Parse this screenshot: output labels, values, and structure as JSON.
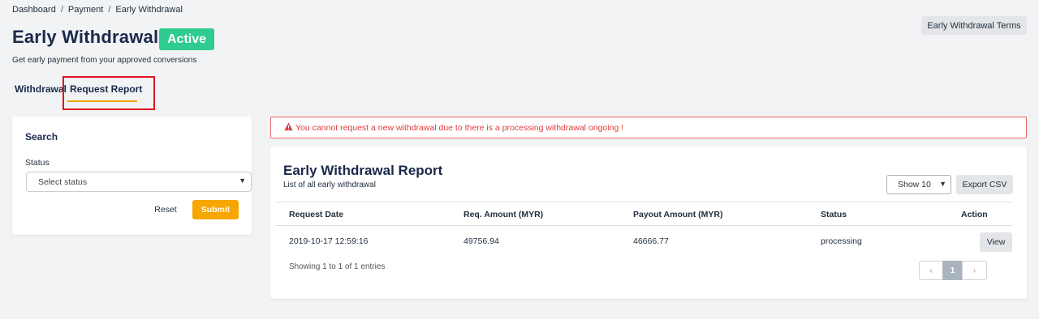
{
  "breadcrumb": [
    "Dashboard",
    "Payment",
    "Early Withdrawal"
  ],
  "header": {
    "title": "Early Withdrawal",
    "status_badge": "Active",
    "subtitle": "Get early payment from your approved conversions",
    "terms_button": "Early Withdrawal Terms"
  },
  "tabs": [
    {
      "label": "Withdrawal"
    },
    {
      "label": "Request Report",
      "active": true
    }
  ],
  "search": {
    "title": "Search",
    "status_label": "Status",
    "status_placeholder": "Select status",
    "reset_label": "Reset",
    "submit_label": "Submit"
  },
  "alert": {
    "message": "You cannot request a new withdrawal due to there is a processing withdrawal ongoing !",
    "icon": "warning-triangle-icon",
    "color": "#e23b3b"
  },
  "report": {
    "title": "Early Withdrawal Report",
    "subtitle": "List of all early withdrawal",
    "show_select": "Show 10",
    "export_label": "Export CSV",
    "columns": [
      "Request Date",
      "Req. Amount (MYR)",
      "Payout Amount (MYR)",
      "Status",
      "Action"
    ],
    "rows": [
      {
        "request_date": "2019-10-17 12:59:16",
        "req_amount": "49756.94",
        "payout_amount": "46666.77",
        "status": "processing",
        "action": "View"
      }
    ],
    "showing": "Showing 1 to 1 of 1 entries",
    "pagination": {
      "prev": "‹",
      "current": "1",
      "next": "›"
    }
  },
  "colors": {
    "accent": "#f7a600",
    "badge": "#2ecc8f",
    "highlight": "#e0141e"
  }
}
